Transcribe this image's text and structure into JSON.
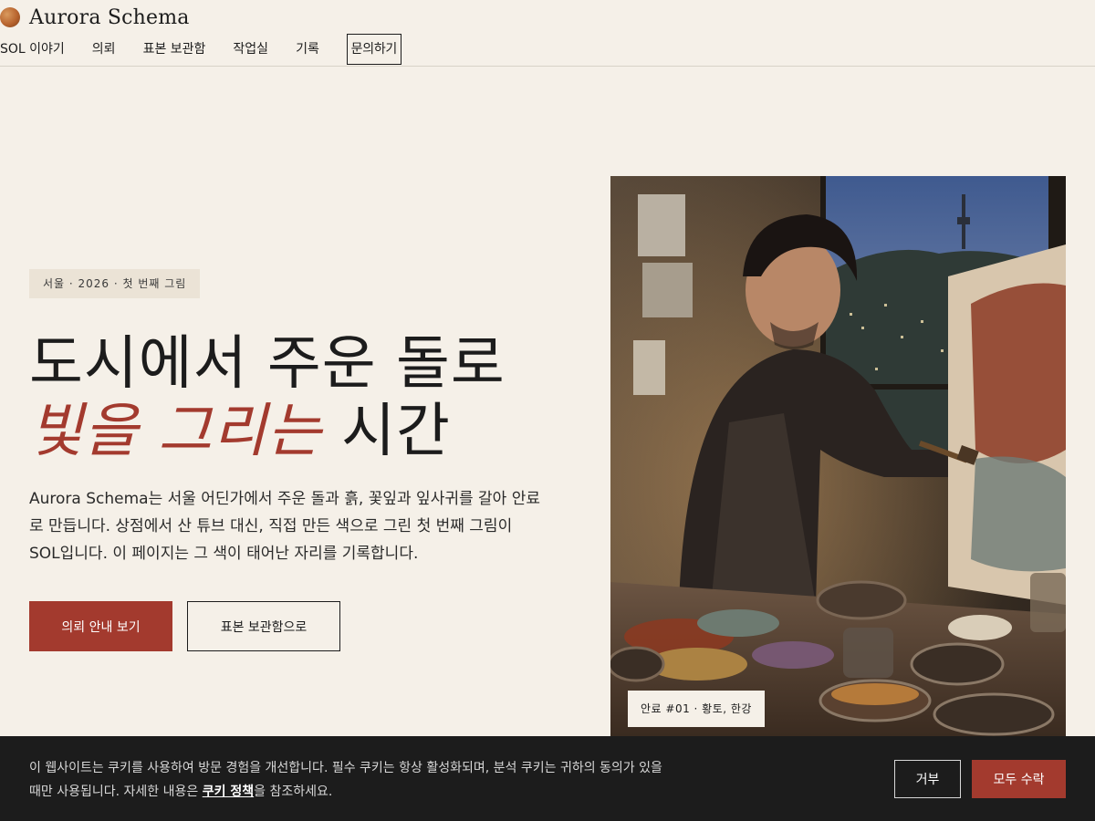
{
  "brand": {
    "name": "Aurora Schema",
    "logo_icon": "ochre-circle-icon"
  },
  "nav": {
    "items": [
      "SOL 이야기",
      "의뢰",
      "표본 보관함",
      "작업실",
      "기록",
      "문의하기"
    ],
    "focused_index": 5
  },
  "hero": {
    "eyebrow": "서울 · 2026 · 첫 번째 그림",
    "headline_line1": "도시에서 주운 돌로",
    "headline_accent": "빛을 그리는",
    "headline_rest": " 시간",
    "lead": "Aurora Schema는 서울 어딘가에서 주운 돌과 흙, 꽃잎과 잎사귀를 갈아 안료로 만듭니다. 상점에서 산 튜브 대신, 직접 만든 색으로 그린 첫 번째 그림이 SOL입니다. 이 페이지는 그 색이 태어난 자리를 기록합니다.",
    "primary_button": "의뢰 안내 보기",
    "secondary_button": "표본 보관함으로",
    "caption": "안료 #01 · 황토, 한강"
  },
  "cookie": {
    "text_before": "이 웹사이트는 쿠키를 사용하여 방문 경험을 개선합니다. 필수 쿠키는 항상 활성화되며, 분석 쿠키는 귀하의 동의가 있을 때만 사용됩니다. 자세한 내용은 ",
    "link": "쿠키 정책",
    "text_after": "을 참조하세요.",
    "reject": "거부",
    "accept": "모두 수락"
  },
  "colors": {
    "background": "#f5f0e8",
    "accent": "#a33a2e",
    "text": "#1c1c1c",
    "cookie_bar": "#1c1c1c"
  }
}
